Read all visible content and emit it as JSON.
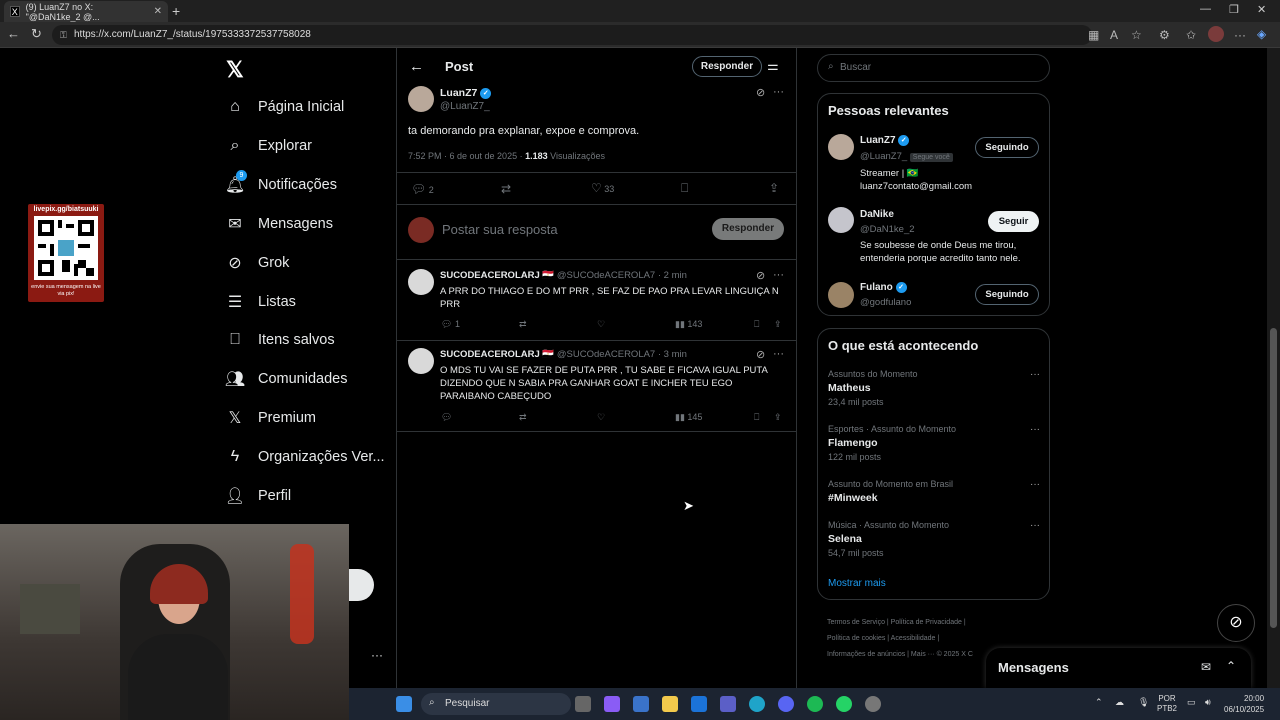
{
  "browser": {
    "tab_title": "(9) LuanZ7 no X: \"@DaN1ke_2 @...",
    "url": "https://x.com/LuanZ7_/status/1975333372537758028"
  },
  "nav": {
    "items": [
      {
        "label": "Página Inicial",
        "icon": "home-icon"
      },
      {
        "label": "Explorar",
        "icon": "search-icon"
      },
      {
        "label": "Notificações",
        "icon": "bell-icon",
        "badge": "9"
      },
      {
        "label": "Mensagens",
        "icon": "mail-icon"
      },
      {
        "label": "Grok",
        "icon": "grok-icon"
      },
      {
        "label": "Listas",
        "icon": "list-icon"
      },
      {
        "label": "Itens salvos",
        "icon": "bookmark-icon"
      },
      {
        "label": "Comunidades",
        "icon": "communities-icon"
      },
      {
        "label": "Premium",
        "icon": "x-icon"
      },
      {
        "label": "Organizações Ver...",
        "icon": "lightning-icon"
      },
      {
        "label": "Perfil",
        "icon": "person-icon"
      }
    ]
  },
  "overlay": {
    "qr_top": "livepix.gg/biatsuuki",
    "qr_bottom": "envie sua mensagem na live via pix!"
  },
  "header": {
    "title": "Post",
    "reply_button": "Responder"
  },
  "main_post": {
    "name": "LuanZ7",
    "handle": "@LuanZ7_",
    "text": "ta demorando pra explanar, expoe e comprova.",
    "time": "7:52 PM · 6 de out de 2025 ·",
    "views": "1.183",
    "views_label": "Visualizações",
    "replies": "2",
    "likes": "33"
  },
  "compose": {
    "placeholder": "Postar sua resposta",
    "button": "Responder"
  },
  "replies": [
    {
      "name": "SUCODEACEROLARJ",
      "handle": "@SUCOdeACEROLA7 · 2 min",
      "text": "A PRR DO THIAGO E DO MT PRR , SE FAZ DE PAO PRA LEVAR LINGUIÇA N PRR",
      "replies": "1",
      "views": "143"
    },
    {
      "name": "SUCODEACEROLARJ",
      "handle": "@SUCOdeACEROLA7 · 3 min",
      "text": "O MDS TU VAI SE FAZER DE PUTA PRR , TU SABE E FICAVA IGUAL PUTA DIZENDO QUE N SABIA PRA GANHAR GOAT E INCHER TEU EGO PARAIBANO CABEÇUDO",
      "replies": "",
      "views": "145"
    }
  ],
  "search": {
    "placeholder": "Buscar"
  },
  "relevant": {
    "title": "Pessoas relevantes",
    "people": [
      {
        "name": "LuanZ7",
        "handle": "@LuanZ7_",
        "follows_you": "Segue você",
        "bio": "Streamer | 🇧🇷 luanz7contato@gmail.com",
        "button": "Seguindo"
      },
      {
        "name": "DaNike",
        "handle": "@DaN1ke_2",
        "bio": "Se soubesse de onde Deus me tirou, entenderia porque acredito tanto nele.",
        "button": "Seguir"
      },
      {
        "name": "Fulano",
        "handle": "@godfulano",
        "bio": "",
        "button": "Seguindo"
      }
    ]
  },
  "trends": {
    "title": "O que está acontecendo",
    "items": [
      {
        "meta": "Assuntos do Momento",
        "name": "Matheus",
        "count": "23,4 mil posts"
      },
      {
        "meta": "Esportes · Assunto do Momento",
        "name": "Flamengo",
        "count": "122 mil posts"
      },
      {
        "meta": "Assunto do Momento em Brasil",
        "name": "#Minweek",
        "count": ""
      },
      {
        "meta": "Música · Assunto do Momento",
        "name": "Selena",
        "count": "54,7 mil posts"
      }
    ],
    "more": "Mostrar mais"
  },
  "footer_links": {
    "line1": "Termos de Serviço  |  Política de Privacidade  |",
    "line2": "Política de cookies  |  Acessibilidade  |",
    "line3": "Informações de anúncios  |  Mais ···  © 2025 X C"
  },
  "messages_dock": {
    "title": "Mensagens"
  },
  "taskbar": {
    "search": "Pesquisar",
    "lang": "POR",
    "lang2": "PTB2",
    "time": "20:00",
    "date": "06/10/2025"
  }
}
